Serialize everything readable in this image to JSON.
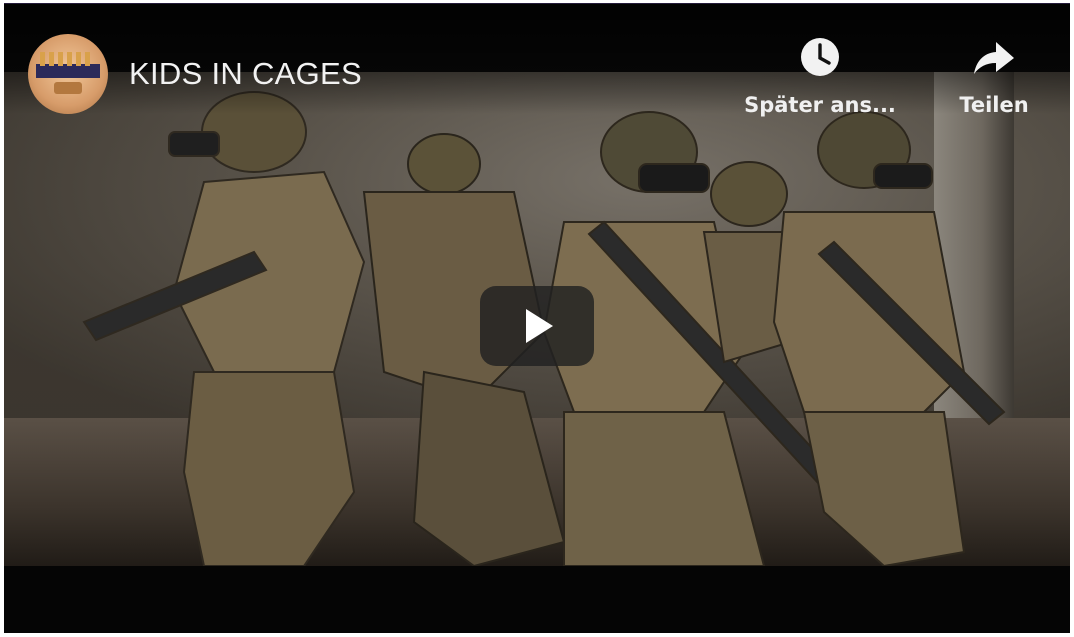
{
  "video": {
    "title": "KIDS IN CAGES",
    "channel_avatar_icon": "channel-avatar",
    "play_icon": "play-icon"
  },
  "actions": {
    "watch_later": {
      "label": "Später ans...",
      "icon": "clock-icon"
    },
    "share": {
      "label": "Teilen",
      "icon": "share-arrow-icon"
    }
  },
  "colors": {
    "frame_background": "#0a0a0a",
    "text": "#f2f2f2",
    "play_button_bg": "#212121"
  }
}
